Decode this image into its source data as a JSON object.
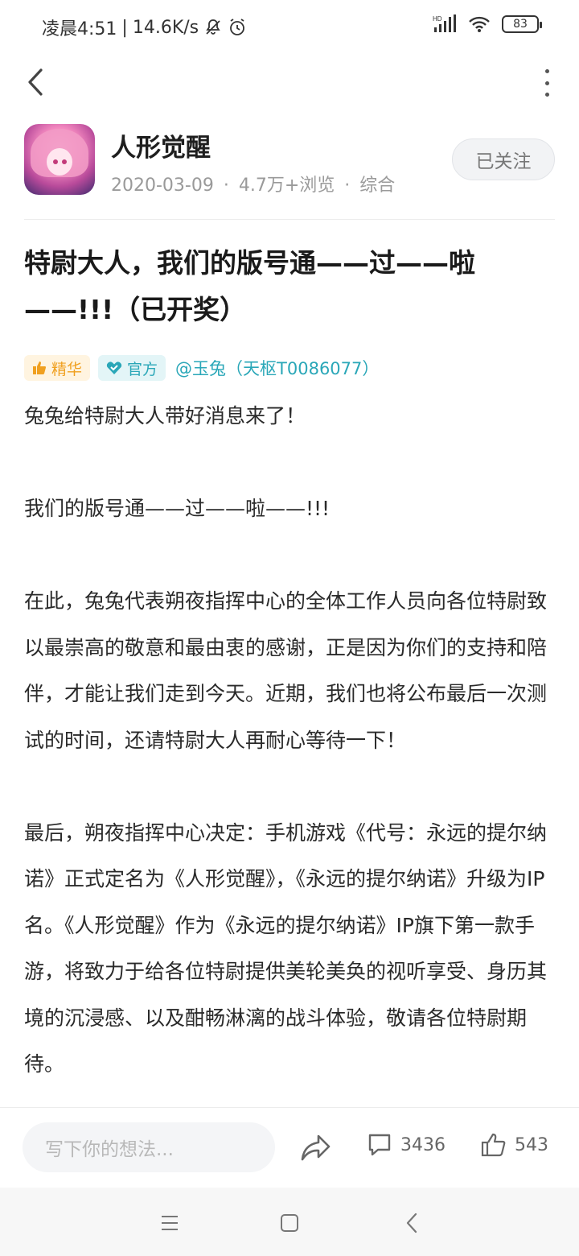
{
  "status_bar": {
    "time": "凌晨4:51",
    "speed": "14.6K/s",
    "battery": "83",
    "icons": [
      "mute-bell-icon",
      "alarm-icon",
      "hd-signal-icon",
      "wifi-icon",
      "battery-icon"
    ]
  },
  "header": {
    "back_icon": "chevron-left-icon",
    "more_icon": "more-vertical-icon"
  },
  "author": {
    "name": "人形觉醒",
    "date": "2020-03-09",
    "sep": "·",
    "views": "4.7万+浏览",
    "category": "综合",
    "follow_label": "已关注"
  },
  "post": {
    "title": "特尉大人，我们的版号通——过——啦——!!!（已开奖）",
    "tags": {
      "jinghua": "精华",
      "guanfang": "官方",
      "author_mention": "@玉兔（天枢T0086077）"
    },
    "paragraphs": [
      "兔兔给特尉大人带好消息来了！",
      "我们的版号通——过——啦——!!!",
      "在此，兔兔代表朔夜指挥中心的全体工作人员向各位特尉致以最崇高的敬意和最由衷的感谢，正是因为你们的支持和陪伴，才能让我们走到今天。近期，我们也将公布最后一次测试的时间，还请特尉大人再耐心等待一下！",
      "最后，朔夜指挥中心决定：手机游戏《代号：永远的提尔纳诺》正式定名为《人形觉醒》，《永远的提尔纳诺》升级为IP名。《人形觉醒》作为《永远的提尔纳诺》IP旗下第一款手游，将致力于给各位特尉提供美轮美奂的视听享受、身历其境的沉浸感、以及酣畅淋漓的战斗体验，敬请各位特尉期待。"
    ]
  },
  "action_bar": {
    "comment_placeholder": "写下你的想法...",
    "share_icon": "share-icon",
    "comment_count": "3436",
    "like_count": "543"
  },
  "system_nav": {
    "icons": [
      "menu-icon",
      "home-square-icon",
      "back-triangle-icon"
    ]
  },
  "colors": {
    "accent_teal": "#2aa7b8",
    "jinghua_orange": "#f0a020",
    "text_main": "#2a2a2a",
    "text_muted": "#9a9a9a"
  }
}
